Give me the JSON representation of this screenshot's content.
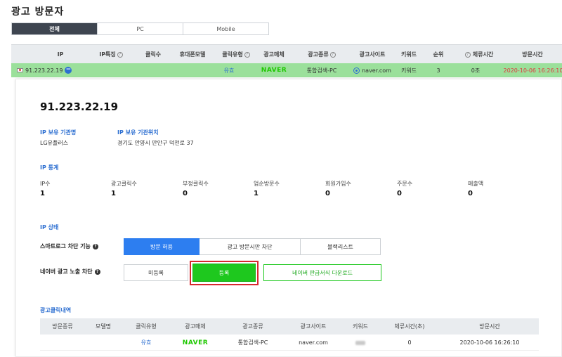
{
  "page_title": "광고 방문자",
  "tabs": [
    {
      "label": "전체",
      "active": true
    },
    {
      "label": "PC",
      "active": false
    },
    {
      "label": "Mobile",
      "active": false
    }
  ],
  "table_headers": {
    "ip": "IP",
    "ip_feature": "IP특징",
    "clicks": "클릭수",
    "phone_model": "휴대폰모델",
    "click_type": "클릭유형",
    "ad_media": "광고매체",
    "ad_type": "광고종류",
    "ad_site": "광고사이트",
    "keyword": "키워드",
    "rank": "순위",
    "stay_time": "체류시간",
    "visit_time": "방문시간"
  },
  "selected_row": {
    "ip": "91.223.22.19",
    "click_type": "유효",
    "ad_media": "NAVER",
    "ad_type": "통합검색-PC",
    "ad_site": "naver.com",
    "keyword": "키워드",
    "rank": "3",
    "stay_time": "0조",
    "visit_time": "2020-10-06 16:26:10"
  },
  "detail": {
    "ip": "91.223.22.19",
    "org_name_label": "IP 보유 기관명",
    "org_name_value": "LG유플러스",
    "org_location_label": "IP 보유 기관위치",
    "org_location_value": "경기도 안양시 만안구 덕천로 37",
    "stats_title": "IP 통계",
    "stats": [
      {
        "label": "IP수",
        "value": "1"
      },
      {
        "label": "광고클릭수",
        "value": "1"
      },
      {
        "label": "부정클릭수",
        "value": "0"
      },
      {
        "label": "업순방문수",
        "value": "1"
      },
      {
        "label": "회원가입수",
        "value": "0"
      },
      {
        "label": "주문수",
        "value": "0"
      },
      {
        "label": "매출액",
        "value": "0"
      }
    ],
    "status_title": "IP 상태",
    "smartlog_label": "스마트로그 차단 기능",
    "smartlog_options": [
      "방문 허용",
      "광고 방문시만 차단",
      "블랙리스트"
    ],
    "naver_label": "네이버 광고 노출 차단",
    "unregistered_button": "미등록",
    "register_button": "등록",
    "download_button": "네이버 판급서식 다운로드",
    "history_title": "광고클릭내역"
  },
  "history_headers": [
    "방문종류",
    "모델명",
    "클릭유형",
    "광고매체",
    "광고종류",
    "광고사이트",
    "키워드",
    "체류시간(초)",
    "방문시간"
  ],
  "history_rows": [
    {
      "visit_type": "",
      "model": "",
      "click_type": "유효",
      "ad_media": "NAVER",
      "ad_type": "통합검색-PC",
      "ad_site": "naver.com",
      "stay_time": "0",
      "visit_time": "2020-10-06 16:26:10"
    }
  ],
  "colors": {
    "accent_blue": "#2d7ef0",
    "naver_green": "#1ec800",
    "row_green": "#9be09b",
    "highlight_red": "#d8282e"
  }
}
